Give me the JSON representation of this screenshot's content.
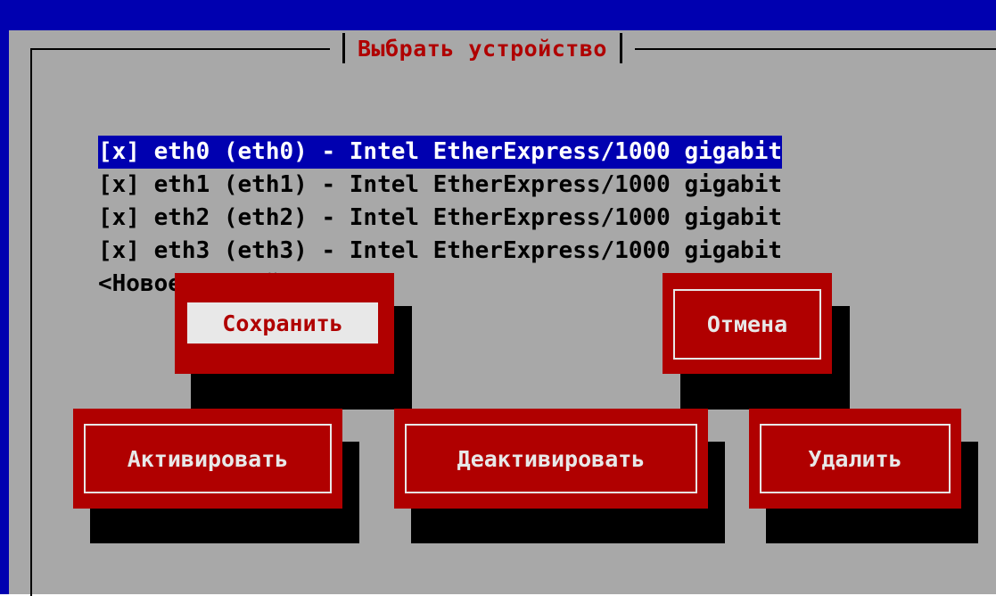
{
  "dialog": {
    "title": "Выбрать устройство"
  },
  "devices": [
    {
      "label": "[x] eth0 (eth0) - Intel EtherExpress/1000 gigabit",
      "selected": true
    },
    {
      "label": "[x] eth1 (eth1) - Intel EtherExpress/1000 gigabit",
      "selected": false
    },
    {
      "label": "[x] eth2 (eth2) - Intel EtherExpress/1000 gigabit",
      "selected": false
    },
    {
      "label": "[x] eth3 (eth3) - Intel EtherExpress/1000 gigabit",
      "selected": false
    }
  ],
  "new_device_label": "<Новое устройство>",
  "buttons": {
    "save": "Сохранить",
    "cancel": "Отмена",
    "activate": "Активировать",
    "deactivate": "Деактивировать",
    "delete": "Удалить"
  },
  "colors": {
    "background_blue": "#0000b0",
    "dialog_gray": "#a8a8a8",
    "button_red": "#b00000",
    "selection_blue": "#0000b0"
  }
}
